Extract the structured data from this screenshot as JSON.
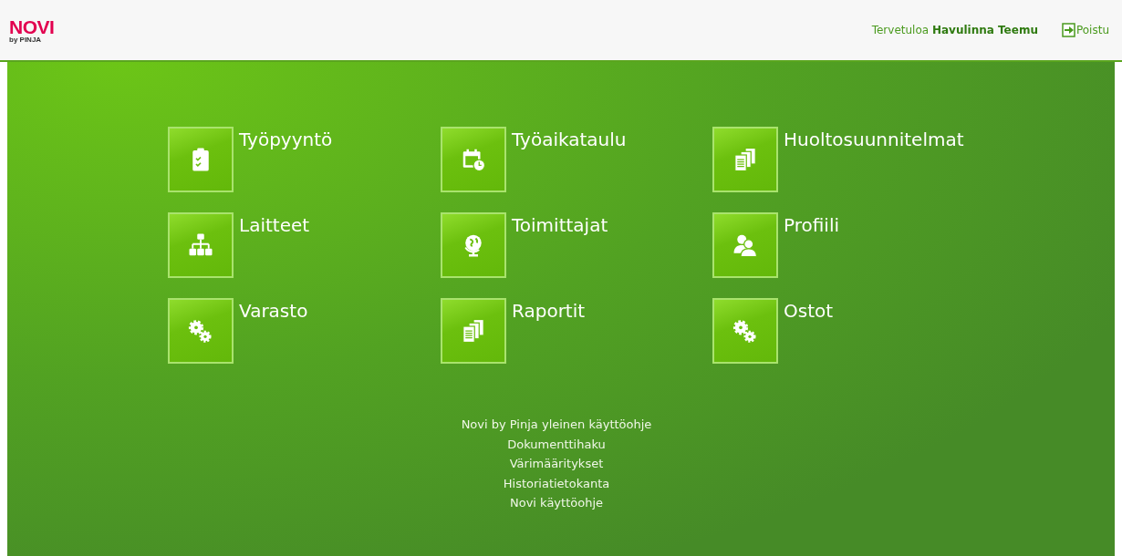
{
  "header": {
    "logo": "NOVI",
    "logo_sub": "by PINJA",
    "welcome": "Tervetuloa **Havulinna Teemu**",
    "logout": "Poistu"
  },
  "tiles": [
    {
      "label": "Työpyyntö",
      "kind": "clipboard"
    },
    {
      "label": "Työaikataulu",
      "kind": "calendar"
    },
    {
      "label": "Huoltosuunnitelmat",
      "kind": "documents"
    },
    {
      "label": "Laitteet",
      "kind": "hierarchy"
    },
    {
      "label": "Toimittajat",
      "kind": "globe"
    },
    {
      "label": "Profiili",
      "kind": "people"
    },
    {
      "label": "Varasto",
      "kind": "gears"
    },
    {
      "label": "Raportit",
      "kind": "documents"
    },
    {
      "label": "Ostot",
      "kind": "gears"
    }
  ],
  "links": [
    "Novi by Pinja yleinen käyttöohje",
    "Dokumenttihaku",
    "Värimääritykset",
    "Historiatietokanta",
    "Novi käyttöohje"
  ]
}
